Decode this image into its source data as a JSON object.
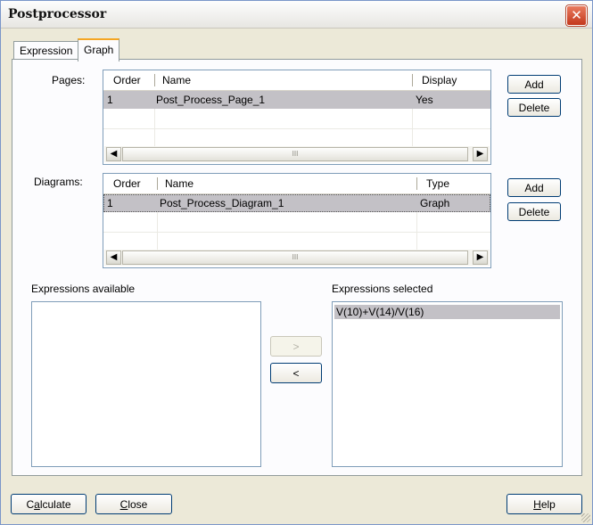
{
  "window": {
    "title": "Postprocessor",
    "close": "✕"
  },
  "tabs": [
    {
      "label": "Expression",
      "active": false
    },
    {
      "label": "Graph",
      "active": true
    }
  ],
  "pages": {
    "label": "Pages:",
    "columns": [
      "Order",
      "Name",
      "Display"
    ],
    "rows": [
      {
        "order": "1",
        "name": "Post_Process_Page_1",
        "display": "Yes",
        "selected": true
      }
    ],
    "add": "Add",
    "delete": "Delete"
  },
  "diagrams": {
    "label": "Diagrams:",
    "columns": [
      "Order",
      "Name",
      "Type"
    ],
    "rows": [
      {
        "order": "1",
        "name": "Post_Process_Diagram_1",
        "type": "Graph",
        "selected": true
      }
    ],
    "add": "Add",
    "delete": "Delete"
  },
  "scroll": {
    "left": "◀",
    "right": "▶",
    "thumb": "III"
  },
  "expressions_available": {
    "label": "Expressions available",
    "items": []
  },
  "expressions_selected": {
    "label": "Expressions selected",
    "items": [
      "V(10)+V(14)/V(16)"
    ]
  },
  "transfer": {
    "add": ">",
    "remove": "<"
  },
  "footer": {
    "calculate_accel": "a",
    "calculate_pre": "C",
    "calculate_post": "lculate",
    "close_accel": "C",
    "close_post": "lose",
    "help_accel": "H",
    "help_post": "elp"
  }
}
